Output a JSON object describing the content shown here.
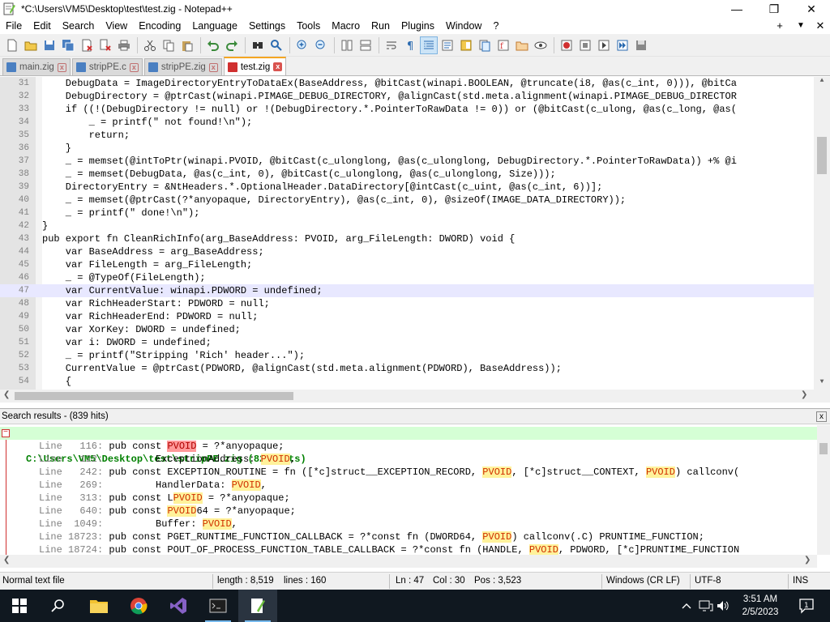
{
  "window": {
    "title": "*C:\\Users\\VM5\\Desktop\\test\\test.zig - Notepad++",
    "minimize": "—",
    "maximize": "❐",
    "close": "✕"
  },
  "menu": [
    "File",
    "Edit",
    "Search",
    "View",
    "Encoding",
    "Language",
    "Settings",
    "Tools",
    "Macro",
    "Run",
    "Plugins",
    "Window",
    "?"
  ],
  "menu_right": {
    "add": "+",
    "dropdown": "▼",
    "close": "✕"
  },
  "tabs": [
    {
      "label": "main.zig",
      "active": false
    },
    {
      "label": "stripPE.c",
      "active": false
    },
    {
      "label": "stripPE.zig",
      "active": false
    },
    {
      "label": "test.zig",
      "active": true
    }
  ],
  "editor": {
    "current_line": 47,
    "lines": [
      {
        "n": "31",
        "text": "    DebugData = ImageDirectoryEntryToDataEx(BaseAddress, @bitCast(winapi.BOOLEAN, @truncate(i8, @as(c_int, 0))), @bitCa"
      },
      {
        "n": "32",
        "text": "    DebugDirectory = @ptrCast(winapi.PIMAGE_DEBUG_DIRECTORY, @alignCast(std.meta.alignment(winapi.PIMAGE_DEBUG_DIRECTOR"
      },
      {
        "n": "33",
        "text": "    if ((!(DebugDirectory != null) or !(DebugDirectory.*.PointerToRawData != 0)) or (@bitCast(c_ulong, @as(c_long, @as("
      },
      {
        "n": "34",
        "text": "        _ = printf(\" not found!\\n\");"
      },
      {
        "n": "35",
        "text": "        return;"
      },
      {
        "n": "36",
        "text": "    }"
      },
      {
        "n": "37",
        "text": "    _ = memset(@intToPtr(winapi.PVOID, @bitCast(c_ulonglong, @as(c_ulonglong, DebugDirectory.*.PointerToRawData)) +% @i"
      },
      {
        "n": "38",
        "text": "    _ = memset(DebugData, @as(c_int, 0), @bitCast(c_ulonglong, @as(c_ulonglong, Size)));"
      },
      {
        "n": "39",
        "text": "    DirectoryEntry = &NtHeaders.*.OptionalHeader.DataDirectory[@intCast(c_uint, @as(c_int, 6))];"
      },
      {
        "n": "40",
        "text": "    _ = memset(@ptrCast(?*anyopaque, DirectoryEntry), @as(c_int, 0), @sizeOf(IMAGE_DATA_DIRECTORY));"
      },
      {
        "n": "41",
        "text": "    _ = printf(\" done!\\n\");"
      },
      {
        "n": "42",
        "text": "}"
      },
      {
        "n": "43",
        "text": "pub export fn CleanRichInfo(arg_BaseAddress: PVOID, arg_FileLength: DWORD) void {"
      },
      {
        "n": "44",
        "text": "    var BaseAddress = arg_BaseAddress;"
      },
      {
        "n": "45",
        "text": "    var FileLength = arg_FileLength;"
      },
      {
        "n": "46",
        "text": "    _ = @TypeOf(FileLength);"
      },
      {
        "n": "47",
        "text": "    var CurrentValue: winapi.PDWORD = undefined;"
      },
      {
        "n": "48",
        "text": "    var RichHeaderStart: PDWORD = null;"
      },
      {
        "n": "49",
        "text": "    var RichHeaderEnd: PDWORD = null;"
      },
      {
        "n": "50",
        "text": "    var XorKey: DWORD = undefined;"
      },
      {
        "n": "51",
        "text": "    var i: DWORD = undefined;"
      },
      {
        "n": "52",
        "text": "    _ = printf(\"Stripping 'Rich' header...\");"
      },
      {
        "n": "53",
        "text": "    CurrentValue = @ptrCast(PDWORD, @alignCast(std.meta.alignment(PDWORD), BaseAddress));"
      },
      {
        "n": "54",
        "text": "    {"
      }
    ]
  },
  "search": {
    "header": "Search results - (839 hits)",
    "close": "x",
    "file_line": "C:\\Users\\VM5\\Desktop\\test\\stripPE.zig (825 hits)",
    "results": [
      {
        "lnum": "Line   116:",
        "pre": " pub const ",
        "hit": "PVOID",
        "post": " = ?*anyopaque;",
        "red": true
      },
      {
        "lnum": "Line   122:",
        "pre": "         ExceptionAddress: ",
        "hit": "PVOID",
        "post": ",",
        "red": false
      },
      {
        "lnum": "Line   242:",
        "pre": " pub const EXCEPTION_ROUTINE = fn ([*c]struct__EXCEPTION_RECORD, ",
        "hit": "PVOID",
        "post": ", [*c]struct__CONTEXT, ",
        "hit2": "PVOID",
        "post2": ") callconv(",
        "red": false
      },
      {
        "lnum": "Line   269:",
        "pre": "         HandlerData: ",
        "hit": "PVOID",
        "post": ",",
        "red": false
      },
      {
        "lnum": "Line   313:",
        "pre": " pub const L",
        "hit": "PVOID",
        "post": " = ?*anyopaque;",
        "red": false
      },
      {
        "lnum": "Line   640:",
        "pre": " pub const ",
        "hit": "PVOID",
        "post": "64 = ?*anyopaque;",
        "red": false
      },
      {
        "lnum": "Line  1049:",
        "pre": "         Buffer: ",
        "hit": "PVOID",
        "post": ",",
        "red": false
      },
      {
        "lnum": "Line 18723:",
        "pre": " pub const PGET_RUNTIME_FUNCTION_CALLBACK = ?*const fn (DWORD64, ",
        "hit": "PVOID",
        "post": ") callconv(.C) PRUNTIME_FUNCTION;",
        "red": false
      },
      {
        "lnum": "Line 18724:",
        "pre": " pub const POUT_OF_PROCESS_FUNCTION_TABLE_CALLBACK = ?*const fn (HANDLE, ",
        "hit": "PVOID",
        "post": ", PDWORD, [*c]PRUNTIME_FUNCTION",
        "red": false
      }
    ]
  },
  "status": {
    "type": "Normal text file",
    "length": "length : 8,519",
    "lines": "lines : 160",
    "ln": "Ln : 47",
    "col": "Col : 30",
    "pos": "Pos : 3,523",
    "eol": "Windows (CR LF)",
    "encoding": "UTF-8",
    "mode": "INS"
  },
  "taskbar": {
    "time": "3:51 AM",
    "date": "2/5/2023",
    "notification_count": "1"
  },
  "colors": {
    "accent": "#f5a623",
    "highlight": "#fff29b",
    "found_file_bg": "#d5ffd5",
    "taskbar": "#101820"
  }
}
